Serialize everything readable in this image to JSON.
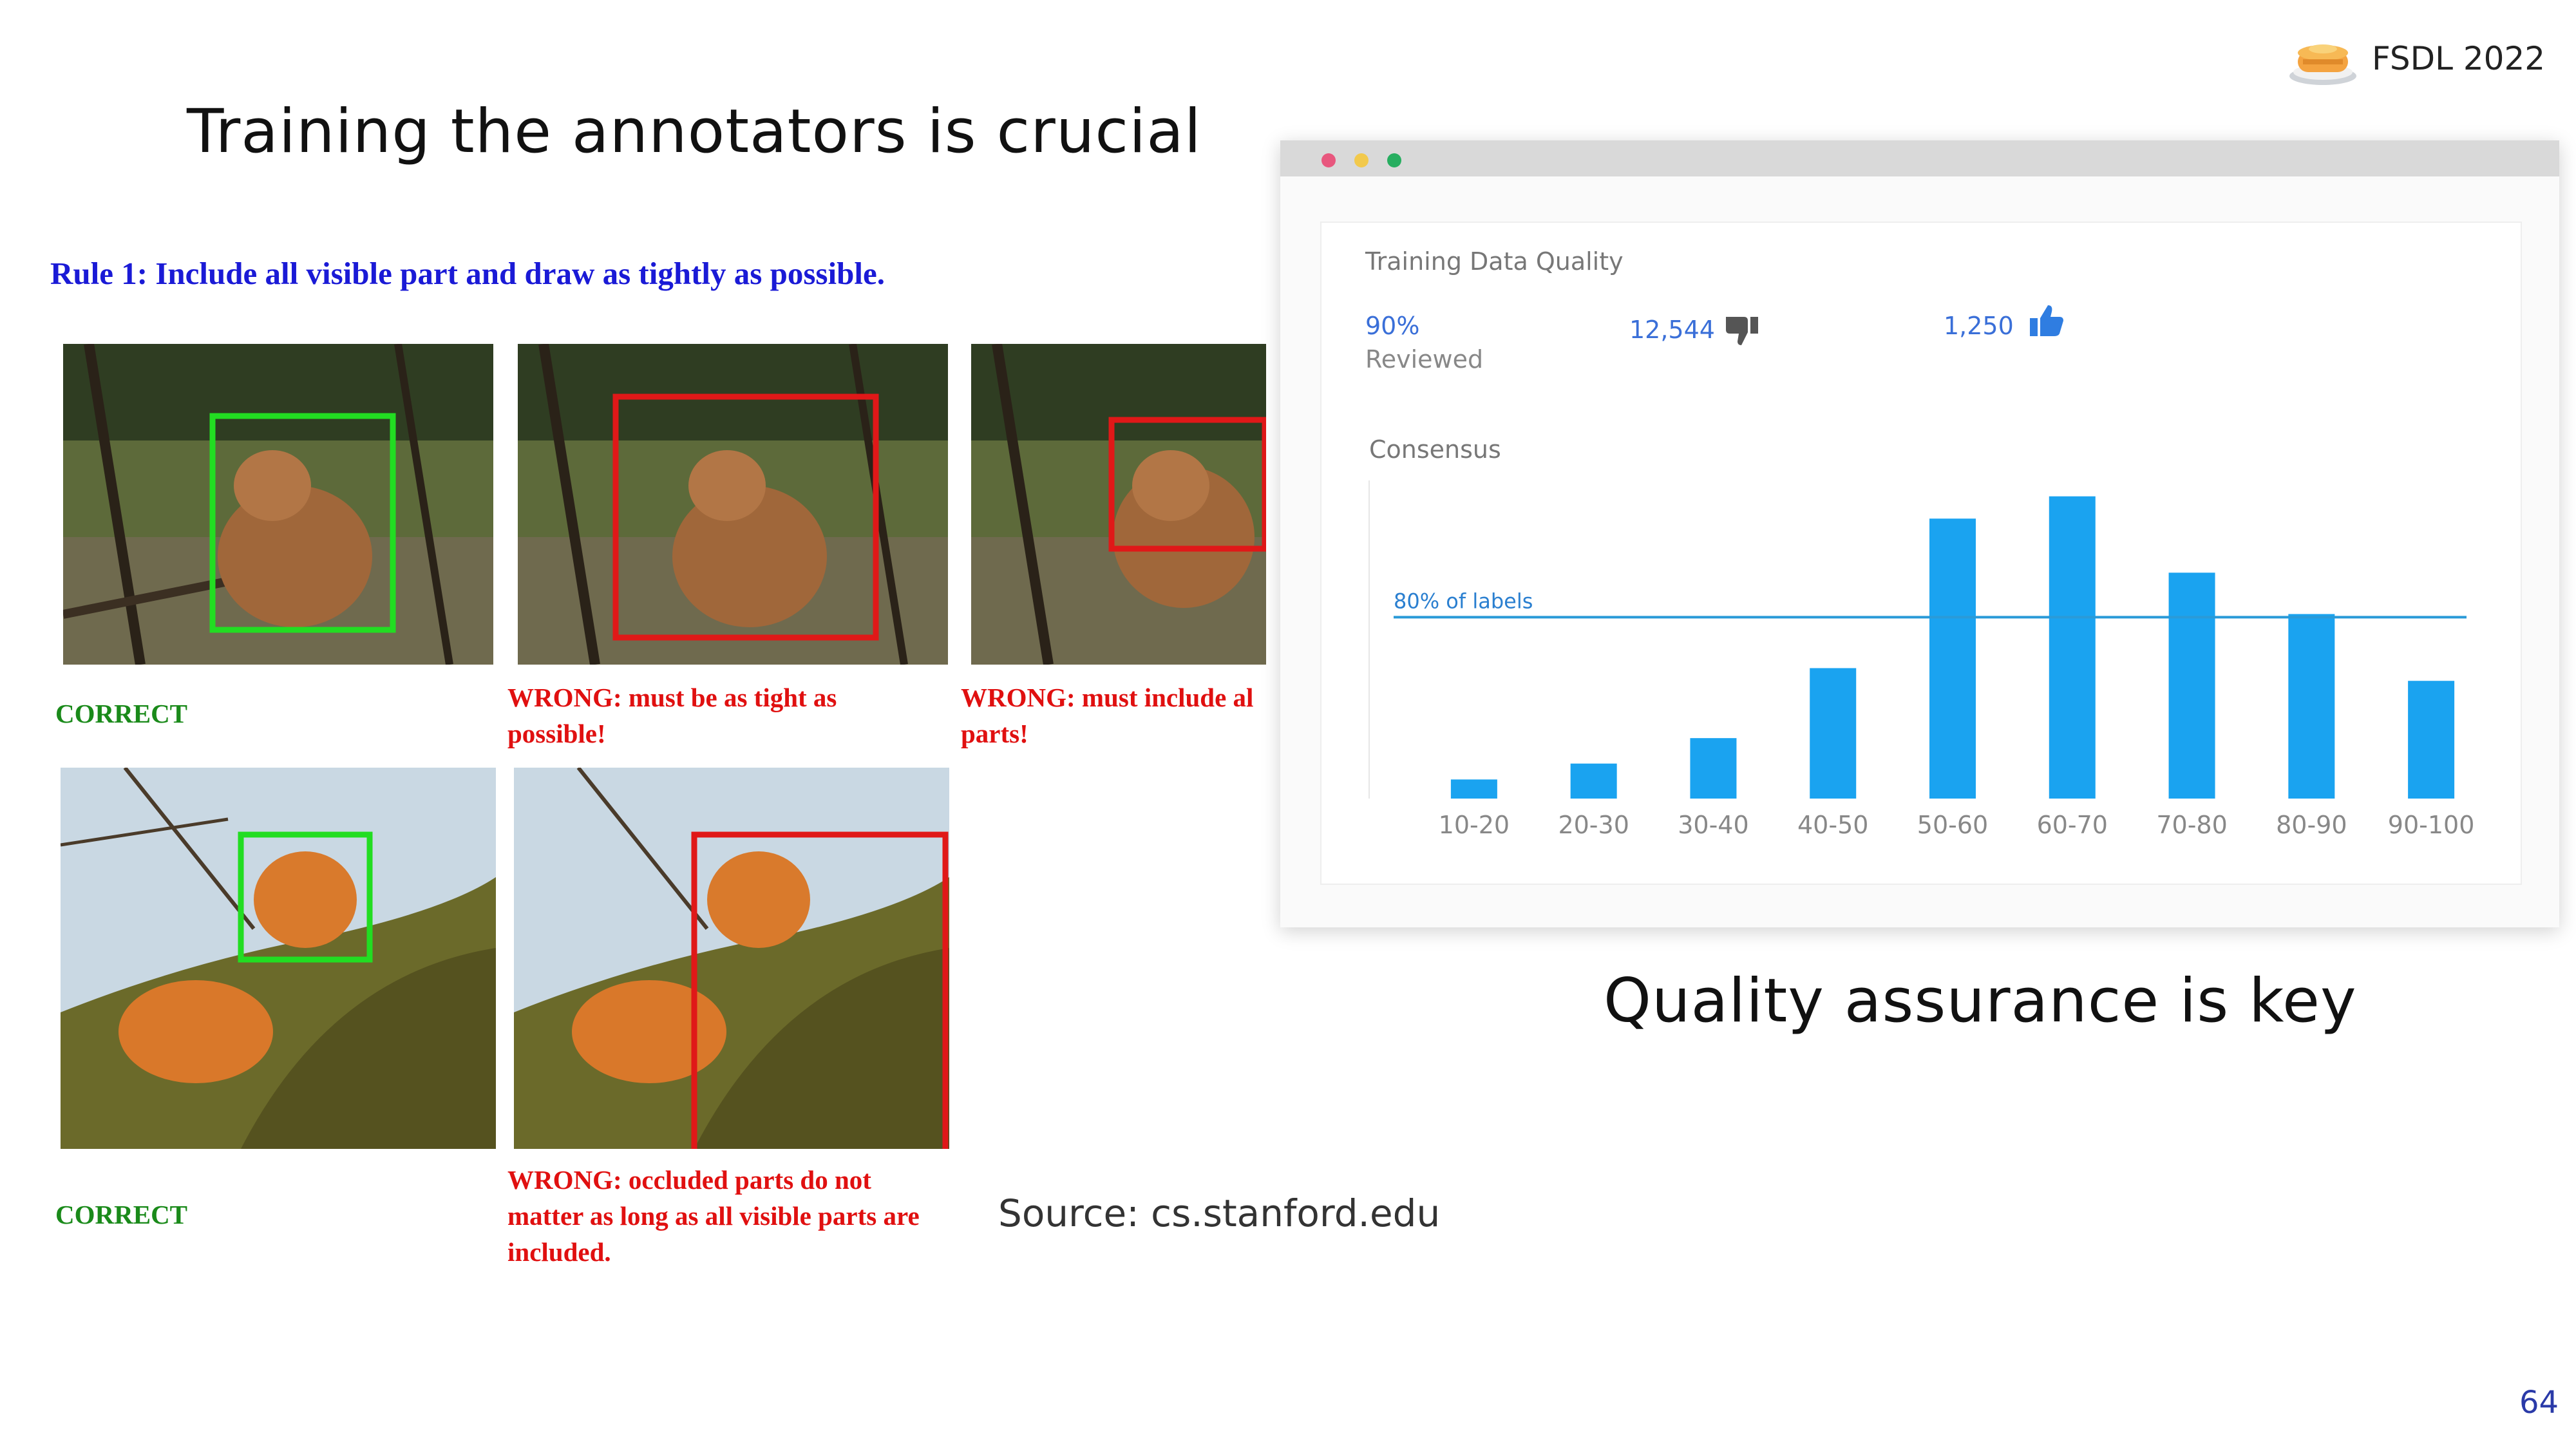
{
  "slide": {
    "title": "Training the annotators is crucial",
    "rule": "Rule 1: Include all visible part and draw as tightly as possible.",
    "source": "Source: cs.stanford.edu",
    "brand": "FSDL 2022",
    "page_number": "64",
    "qa_caption": "Quality assurance is key"
  },
  "examples": {
    "captions": [
      "CORRECT",
      "WRONG: must be as tight as possible!",
      "WRONG: must include al parts!",
      "CORRECT",
      "WRONG: occluded parts do not matter as long as all visible parts are included."
    ]
  },
  "dashboard": {
    "title": "Training Data Quality",
    "reviewed_pct": "90%",
    "reviewed_label": "Reviewed",
    "thumbs_down_count": "12,544",
    "thumbs_up_count": "1,250",
    "consensus_label": "Consensus",
    "threshold_label": "80% of labels",
    "window_dots": [
      "#e8577e",
      "#f2c94c",
      "#27ae60"
    ]
  },
  "chart_data": {
    "type": "bar",
    "categories": [
      "10-20",
      "20-30",
      "30-40",
      "40-50",
      "50-60",
      "60-70",
      "70-80",
      "80-90",
      "90-100"
    ],
    "values": [
      6,
      11,
      19,
      41,
      88,
      95,
      71,
      58,
      37
    ],
    "ylim": [
      0,
      100
    ],
    "threshold": 57,
    "threshold_label": "80% of labels",
    "bar_color": "#1aa3f0",
    "grid": false
  }
}
